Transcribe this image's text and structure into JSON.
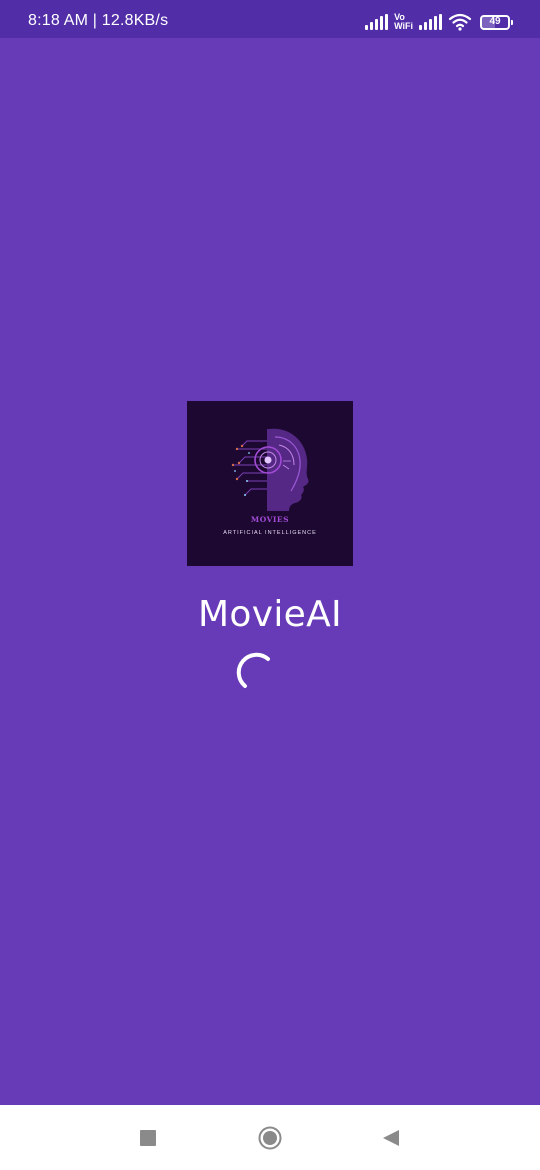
{
  "status_bar": {
    "time_speed": "8:18 AM | 12.8KB/s",
    "vowifi_top": "Vo",
    "vowifi_bottom": "WiFi",
    "battery_level": "49",
    "icons": [
      "signal-icon",
      "vowifi-icon",
      "signal-icon",
      "wifi-icon",
      "battery-icon"
    ]
  },
  "logo": {
    "brand": "MOVIES",
    "tagline": "ARTIFICIAL INTELLIGENCE"
  },
  "app": {
    "title": "MovieAI"
  },
  "loading": {
    "icon": "loading-spinner-icon"
  },
  "nav_bar": {
    "recents_icon": "square-icon",
    "home_icon": "circle-icon",
    "back_icon": "triangle-back-icon"
  },
  "colors": {
    "background": "#673ab7",
    "status_bar": "#512da8",
    "logo_background": "#1c0830",
    "logo_accent": "#a24bd6",
    "text": "#ffffff",
    "nav_bar": "#ffffff"
  }
}
